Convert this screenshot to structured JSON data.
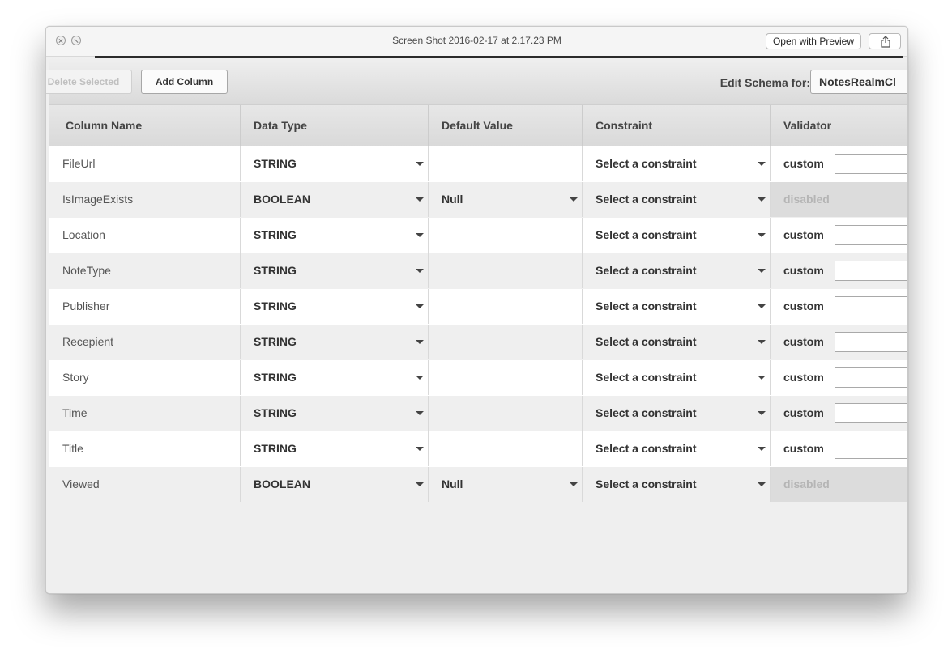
{
  "window": {
    "title": "Screen Shot 2016-02-17 at 2.17.23 PM",
    "open_with_preview": "Open with Preview"
  },
  "toolbar": {
    "delete_selected": "Delete Selected",
    "add_column": "Add Column",
    "edit_schema_label": "Edit Schema for:",
    "schema_value": "NotesRealmCl"
  },
  "columns": {
    "name": "Column Name",
    "type": "Data Type",
    "default": "Default Value",
    "constraint": "Constraint",
    "validator": "Validator"
  },
  "rows": [
    {
      "name": "FileUrl",
      "type": "STRING",
      "default": "",
      "constraint": "Select a constraint",
      "validator": "custom"
    },
    {
      "name": "IsImageExists",
      "type": "BOOLEAN",
      "default": "Null",
      "constraint": "Select a constraint",
      "validator": "disabled"
    },
    {
      "name": "Location",
      "type": "STRING",
      "default": "",
      "constraint": "Select a constraint",
      "validator": "custom"
    },
    {
      "name": "NoteType",
      "type": "STRING",
      "default": "",
      "constraint": "Select a constraint",
      "validator": "custom"
    },
    {
      "name": "Publisher",
      "type": "STRING",
      "default": "",
      "constraint": "Select a constraint",
      "validator": "custom"
    },
    {
      "name": "Recepient",
      "type": "STRING",
      "default": "",
      "constraint": "Select a constraint",
      "validator": "custom"
    },
    {
      "name": "Story",
      "type": "STRING",
      "default": "",
      "constraint": "Select a constraint",
      "validator": "custom"
    },
    {
      "name": "Time",
      "type": "STRING",
      "default": "",
      "constraint": "Select a constraint",
      "validator": "custom"
    },
    {
      "name": "Title",
      "type": "STRING",
      "default": "",
      "constraint": "Select a constraint",
      "validator": "custom"
    },
    {
      "name": "Viewed",
      "type": "BOOLEAN",
      "default": "Null",
      "constraint": "Select a constraint",
      "validator": "disabled"
    }
  ],
  "icons": {
    "close": "close-icon",
    "minimize": "minimize-icon",
    "share": "share-icon",
    "dropdown": "caret-down-icon"
  }
}
